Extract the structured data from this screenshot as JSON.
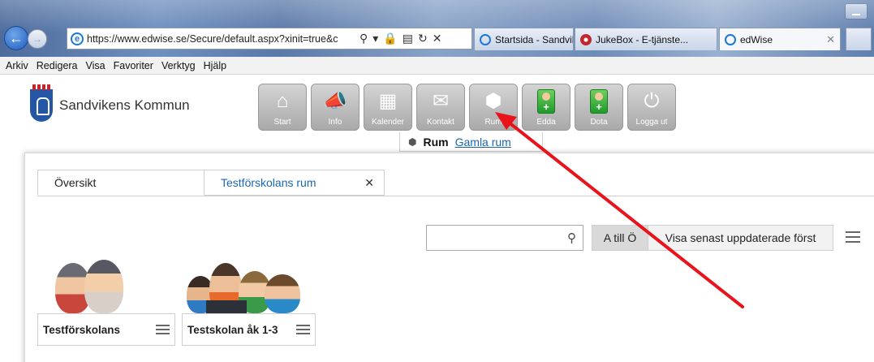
{
  "browser": {
    "url": "https://www.edwise.se/Secure/default.aspx?xinit=true&c",
    "tabs": [
      {
        "label": "Startsida - Sandvik..."
      },
      {
        "label": "JukeBox - E-tjänste..."
      },
      {
        "label": "edWise"
      }
    ],
    "menu": [
      "Arkiv",
      "Redigera",
      "Visa",
      "Favoriter",
      "Verktyg",
      "Hjälp"
    ]
  },
  "site": {
    "logo_text": "Sandvikens Kommun",
    "nav_buttons": [
      {
        "label": "Start",
        "icon": "home-icon"
      },
      {
        "label": "Info",
        "icon": "megaphone-icon"
      },
      {
        "label": "Kalender",
        "icon": "calendar-icon"
      },
      {
        "label": "Kontakt",
        "icon": "mail-icon"
      },
      {
        "label": "Rum",
        "icon": "cube-icon"
      },
      {
        "label": "Edda",
        "icon": "add-person-icon"
      },
      {
        "label": "Dota",
        "icon": "add-person-icon"
      },
      {
        "label": "Logga ut",
        "icon": "power-icon"
      }
    ],
    "subnav": {
      "current": "Rum",
      "link": "Gamla rum"
    }
  },
  "content": {
    "tabs": [
      {
        "label": "Översikt"
      },
      {
        "label": "Testförskolans rum"
      }
    ],
    "search_placeholder": "",
    "sort_options": [
      "A till Ö",
      "Visa senast uppdaterade först"
    ],
    "rooms": [
      {
        "name": "Testförskolans"
      },
      {
        "name": "Testskolan åk 1-3"
      }
    ]
  },
  "colors": {
    "annotation_arrow": "#e8131b",
    "link": "#1a67b0"
  }
}
